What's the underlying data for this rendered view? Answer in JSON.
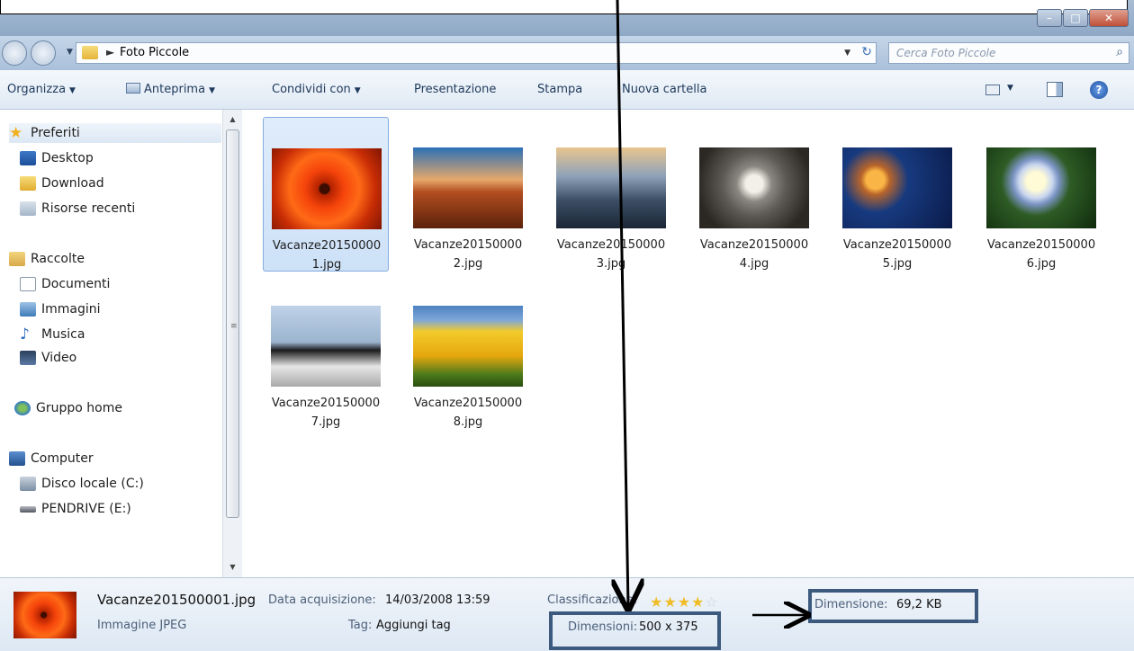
{
  "window": {
    "minimize_glyph": "–",
    "maximize_glyph": "□",
    "close_glyph": "✕"
  },
  "address": {
    "breadcrumb_arrow": "►",
    "current_folder": "Foto Piccole",
    "dropdown_glyph": "▼",
    "refresh_glyph": "↻"
  },
  "search": {
    "placeholder": "Cerca Foto Piccole",
    "icon_glyph": "⌕"
  },
  "toolbar": {
    "organize": "Organizza",
    "preview": "Anteprima",
    "share": "Condividi con",
    "slideshow": "Presentazione",
    "print": "Stampa",
    "new_folder": "Nuova cartella",
    "caret": "▼",
    "help_glyph": "?"
  },
  "sidebar": {
    "favorites": {
      "label": "Preferiti",
      "items": [
        {
          "label": "Desktop",
          "icon": "desktop-icon"
        },
        {
          "label": "Download",
          "icon": "download-folder-icon"
        },
        {
          "label": "Risorse recenti",
          "icon": "recent-places-icon"
        }
      ]
    },
    "libraries": {
      "label": "Raccolte",
      "items": [
        {
          "label": "Documenti",
          "icon": "documents-icon"
        },
        {
          "label": "Immagini",
          "icon": "pictures-icon"
        },
        {
          "label": "Musica",
          "icon": "music-icon"
        },
        {
          "label": "Video",
          "icon": "video-icon"
        }
      ]
    },
    "homegroup": {
      "label": "Gruppo home"
    },
    "computer": {
      "label": "Computer",
      "items": [
        {
          "label": "Disco locale (C:)",
          "icon": "local-disk-icon"
        },
        {
          "label": "PENDRIVE (E:)",
          "icon": "usb-drive-icon"
        }
      ]
    },
    "scroll_up": "▲",
    "scroll_down": "▼",
    "scroll_grip": "≡"
  },
  "files": [
    {
      "line1": "Vacanze20150000",
      "line2": "1.jpg",
      "thumb": "red-flower",
      "selected": true
    },
    {
      "line1": "Vacanze20150000",
      "line2": "2.jpg",
      "thumb": "desert-mesa"
    },
    {
      "line1": "Vacanze20150000",
      "line2": "3.jpg",
      "thumb": "lighthouse"
    },
    {
      "line1": "Vacanze20150000",
      "line2": "4.jpg",
      "thumb": "koala"
    },
    {
      "line1": "Vacanze20150000",
      "line2": "5.jpg",
      "thumb": "jellyfish"
    },
    {
      "line1": "Vacanze20150000",
      "line2": "6.jpg",
      "thumb": "hydrangea"
    },
    {
      "line1": "Vacanze20150000",
      "line2": "7.jpg",
      "thumb": "penguins"
    },
    {
      "line1": "Vacanze20150000",
      "line2": "8.jpg",
      "thumb": "tulips"
    }
  ],
  "details": {
    "filename": "Vacanze201500001.jpg",
    "filetype": "Immagine JPEG",
    "date_label": "Data acquisizione:",
    "date_value": "14/03/2008 13:59",
    "tags_label": "Tag:",
    "tags_value": "Aggiungi tag",
    "rating_label": "Classificazione:",
    "rating_value": 4,
    "rating_max": 5,
    "dimensions_label": "Dimensioni:",
    "dimensions_value": "500 x 375",
    "size_label": "Dimensione:",
    "size_value": "69,2 KB"
  },
  "colors": {
    "accent": "#3c5a7e",
    "selection": "#cde1f7",
    "star": "#f0bd27"
  }
}
